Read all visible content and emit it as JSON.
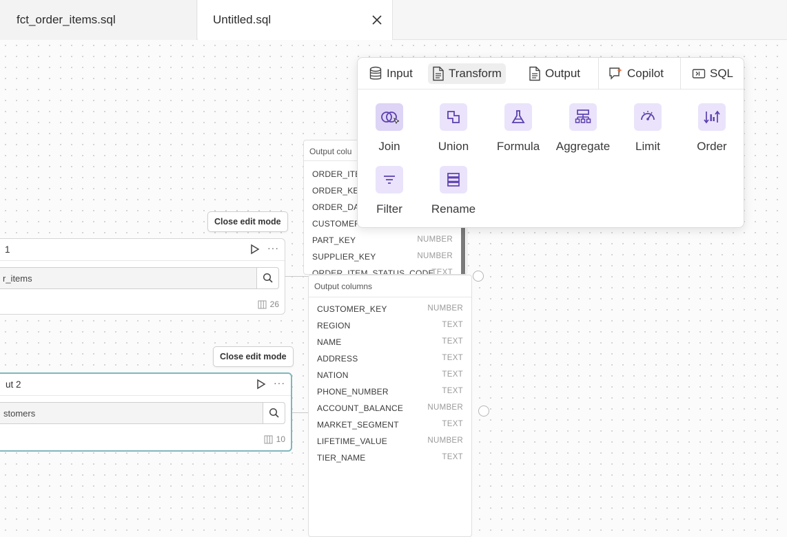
{
  "tabs": [
    {
      "label": "fct_order_items.sql"
    },
    {
      "label": "Untitled.sql"
    }
  ],
  "nodes": {
    "input1": {
      "close_edit": "Close edit mode",
      "title": "1",
      "source": "r_items",
      "column_count": "26"
    },
    "input2": {
      "close_edit": "Close edit mode",
      "title": "ut 2",
      "source": "stomers",
      "column_count": "10"
    }
  },
  "panel1": {
    "title": "Output colu",
    "columns": [
      {
        "name": "ORDER_ITE",
        "type": ""
      },
      {
        "name": "ORDER_KE",
        "type": ""
      },
      {
        "name": "ORDER_DA",
        "type": ""
      },
      {
        "name": "CUSTOMER",
        "type": ""
      },
      {
        "name": "PART_KEY",
        "type": "NUMBER"
      },
      {
        "name": "SUPPLIER_KEY",
        "type": "NUMBER"
      },
      {
        "name": "ORDER_ITEM_STATUS_CODE",
        "type": "TEXT"
      }
    ]
  },
  "panel2": {
    "title": "Output columns",
    "columns": [
      {
        "name": "CUSTOMER_KEY",
        "type": "NUMBER"
      },
      {
        "name": "REGION",
        "type": "TEXT"
      },
      {
        "name": "NAME",
        "type": "TEXT"
      },
      {
        "name": "ADDRESS",
        "type": "TEXT"
      },
      {
        "name": "NATION",
        "type": "TEXT"
      },
      {
        "name": "PHONE_NUMBER",
        "type": "TEXT"
      },
      {
        "name": "ACCOUNT_BALANCE",
        "type": "NUMBER"
      },
      {
        "name": "MARKET_SEGMENT",
        "type": "TEXT"
      },
      {
        "name": "LIFETIME_VALUE",
        "type": "NUMBER"
      },
      {
        "name": "TIER_NAME",
        "type": "TEXT"
      }
    ]
  },
  "popover": {
    "tabs": [
      {
        "label": "Input",
        "icon": "database-icon"
      },
      {
        "label": "Transform",
        "icon": "document-icon",
        "active": true
      },
      {
        "label": "Output",
        "icon": "document-icon"
      },
      {
        "label": "Copilot",
        "icon": "copilot-icon"
      },
      {
        "label": "SQL",
        "icon": "sql-icon"
      }
    ],
    "tools": [
      {
        "label": "Join",
        "icon": "join-icon"
      },
      {
        "label": "Union",
        "icon": "union-icon"
      },
      {
        "label": "Formula",
        "icon": "flask-icon"
      },
      {
        "label": "Aggregate",
        "icon": "aggregate-icon"
      },
      {
        "label": "Limit",
        "icon": "gauge-icon"
      },
      {
        "label": "Order",
        "icon": "sort-icon"
      },
      {
        "label": "Filter",
        "icon": "filter-icon"
      },
      {
        "label": "Rename",
        "icon": "rename-icon"
      }
    ]
  },
  "colors": {
    "accent_purple": "#eae3fb",
    "icon_purple": "#6b4fbb",
    "selected_border": "#7eb6bd"
  }
}
